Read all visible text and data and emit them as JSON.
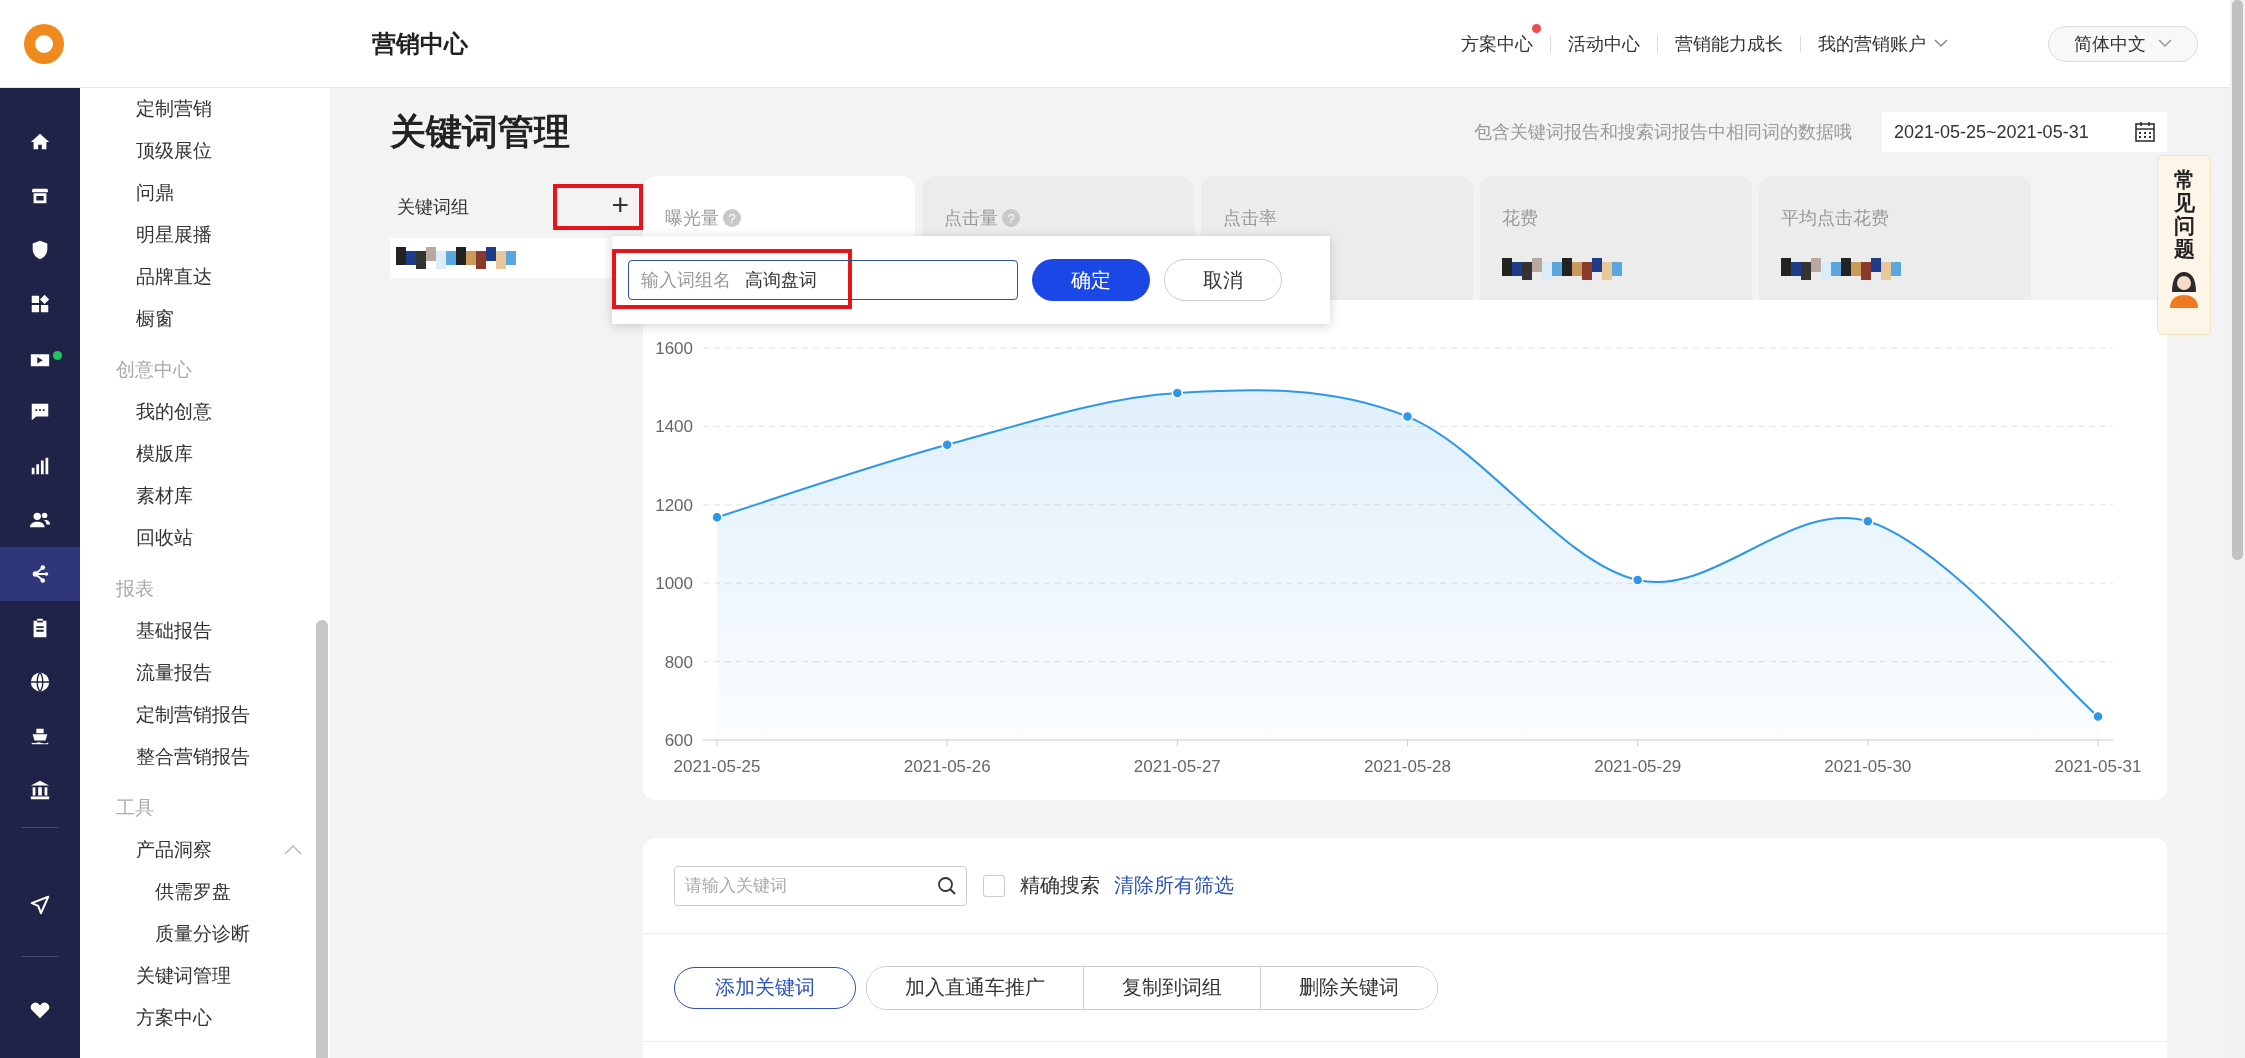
{
  "header": {
    "logo_text": "营销中心",
    "nav": [
      {
        "label": "方案中心",
        "badge": true,
        "dropdown": false
      },
      {
        "label": "活动中心",
        "badge": false,
        "dropdown": false
      },
      {
        "label": "营销能力成长",
        "badge": false,
        "dropdown": false
      },
      {
        "label": "我的营销账户",
        "badge": false,
        "dropdown": true
      }
    ],
    "language": "简体中文"
  },
  "rail": [
    {
      "selected": false,
      "badge": false
    },
    {
      "selected": false,
      "badge": false
    },
    {
      "selected": false,
      "badge": false
    },
    {
      "selected": false,
      "badge": false
    },
    {
      "selected": false,
      "badge": true
    },
    {
      "selected": false,
      "badge": false
    },
    {
      "selected": false,
      "badge": false
    },
    {
      "selected": false,
      "badge": false
    },
    {
      "selected": true,
      "badge": false
    },
    {
      "selected": false,
      "badge": false
    },
    {
      "selected": false,
      "badge": false
    },
    {
      "selected": false,
      "badge": false
    },
    {
      "selected": false,
      "badge": false
    },
    {
      "selected": false,
      "badge": false
    },
    {
      "selected": false,
      "badge": false
    }
  ],
  "nav": {
    "sections": [
      {
        "items": [
          {
            "label": "定制营销"
          },
          {
            "label": "顶级展位"
          },
          {
            "label": "问鼎"
          },
          {
            "label": "明星展播"
          },
          {
            "label": "品牌直达"
          },
          {
            "label": "橱窗"
          }
        ]
      },
      {
        "title": "创意中心",
        "items": [
          {
            "label": "我的创意"
          },
          {
            "label": "模版库"
          },
          {
            "label": "素材库"
          },
          {
            "label": "回收站"
          }
        ]
      },
      {
        "title": "报表",
        "items": [
          {
            "label": "基础报告"
          },
          {
            "label": "流量报告"
          },
          {
            "label": "定制营销报告"
          },
          {
            "label": "整合营销报告"
          }
        ]
      },
      {
        "title": "工具",
        "items": [
          {
            "label": "产品洞察",
            "expanded": true,
            "children": [
              {
                "label": "供需罗盘"
              },
              {
                "label": "质量分诊断"
              }
            ]
          },
          {
            "label": "关键词管理"
          },
          {
            "label": "方案中心"
          }
        ]
      }
    ]
  },
  "page": {
    "title": "关键词管理",
    "hint": "包含关键词报告和搜索词报告中相同词的数据哦",
    "date_range": "2021-05-25~2021-05-31"
  },
  "keyword_groups": {
    "label": "关键词组",
    "add_button": {
      "label": "+",
      "highlighted": true
    },
    "items": [
      {
        "redacted": true
      }
    ],
    "popup": {
      "prefix": "输入词组名",
      "value": "高询盘词",
      "highlighted": true,
      "confirm": "确定",
      "cancel": "取消"
    }
  },
  "metrics": [
    {
      "label": "曝光量",
      "help_mark": "?",
      "selected": true,
      "redacted": false
    },
    {
      "label": "点击量",
      "help_mark": "?",
      "selected": false,
      "redacted": false
    },
    {
      "label": "点击率",
      "selected": false,
      "redacted": false
    },
    {
      "label": "花费",
      "selected": false,
      "redacted": true
    },
    {
      "label": "平均点击花费",
      "selected": false,
      "redacted": true
    }
  ],
  "chart": {
    "chart_data": {
      "type": "area",
      "categories": [
        "2021-05-25",
        "2021-05-26",
        "2021-05-27",
        "2021-05-28",
        "2021-05-29",
        "2021-05-30",
        "2021-05-31"
      ],
      "series": [
        {
          "color": "#2f96e8",
          "values": [
            1168,
            1353,
            1485,
            1425,
            1008,
            1158,
            660
          ]
        }
      ],
      "ylim": [
        600,
        1600
      ],
      "grid": true,
      "yticks": [
        600,
        800,
        1000,
        1200,
        1400,
        1600
      ]
    }
  },
  "help_float": {
    "label": "常见问题"
  },
  "keywords": {
    "search_placeholder": "请输入关键词",
    "exact": {
      "label": "精确搜索",
      "checked": false
    },
    "clear_link": "清除所有筛选",
    "actions": [
      {
        "label": "添加关键词",
        "primary": true
      },
      {
        "label": "加入直通车推广",
        "primary": false
      },
      {
        "label": "复制到词组",
        "primary": false
      },
      {
        "label": "删除关键词",
        "primary": false
      }
    ]
  }
}
